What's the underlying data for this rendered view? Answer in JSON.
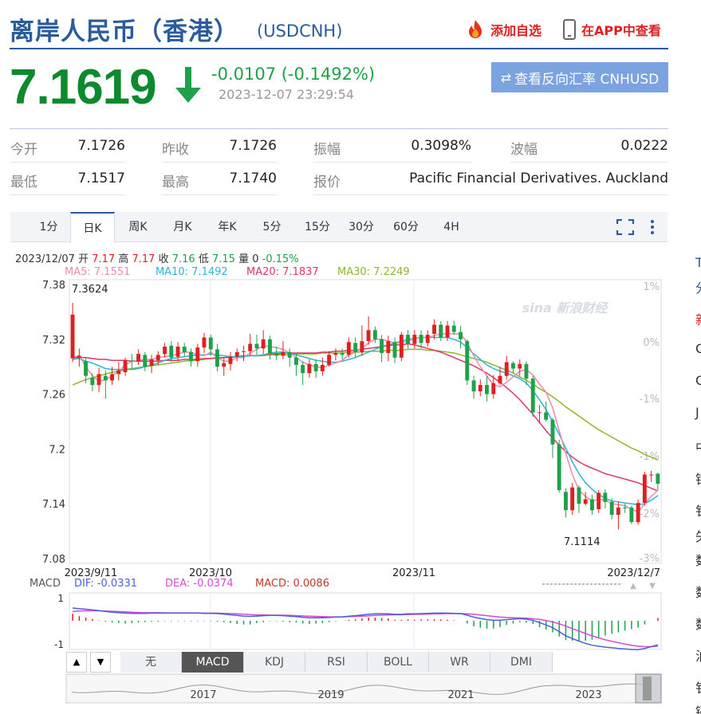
{
  "header": {
    "title": "离岸人民币（香港）",
    "symbol": "(USDCNH)",
    "add_watchlist": "添加自选",
    "view_in_app": "在APP中查看"
  },
  "quote": {
    "price": "7.1619",
    "change": "-0.0107 (-0.1492%)",
    "timestamp": "2023-12-07 23:29:54",
    "reverse_button": "查看反向汇率 CNHUSD",
    "down_color": "#0d8a2d"
  },
  "stats": [
    {
      "label": "今开",
      "value": "7.1726"
    },
    {
      "label": "昨收",
      "value": "7.1726"
    },
    {
      "label": "振幅",
      "value": "0.3098%"
    },
    {
      "label": "波幅",
      "value": "0.0222"
    },
    {
      "label": "最低",
      "value": "7.1517"
    },
    {
      "label": "最高",
      "value": "7.1740"
    },
    {
      "label": "报价",
      "value": "Pacific Financial Derivatives. Auckland"
    }
  ],
  "tabs": [
    "1分",
    "日K",
    "周K",
    "月K",
    "年K",
    "5分",
    "15分",
    "30分",
    "60分",
    "4H"
  ],
  "active_tab": "日K",
  "info_bar": {
    "date": "2023/12/07",
    "open_label": "开",
    "open": "7.17",
    "high_label": "高",
    "high": "7.17",
    "close_label": "收",
    "close": "7.16",
    "low_label": "低",
    "low": "7.15",
    "vol_label": "量",
    "vol": "0",
    "pct": "-0.15%"
  },
  "ma_legend": [
    {
      "text": "MA5: 7.1551",
      "color": "#f08aa8"
    },
    {
      "text": "MA10: 7.1492",
      "color": "#29b6d8"
    },
    {
      "text": "MA20: 7.1837",
      "color": "#e0356a"
    },
    {
      "text": "MA30: 7.2249",
      "color": "#8db82a"
    }
  ],
  "macd_legend": {
    "title": "MACD",
    "dif": "DIF: -0.0331",
    "dea": "DEA: -0.0374",
    "macd": "MACD: 0.0086"
  },
  "indicator_tabs": [
    "无",
    "MACD",
    "KDJ",
    "RSI",
    "BOLL",
    "WR",
    "DMI"
  ],
  "active_indicator": "MACD",
  "watermark": "sina 新浪财经",
  "side_letters": [
    "T",
    "分",
    "新",
    "C",
    "C",
    "J",
    "中",
    "银",
    "钅",
    "矢",
    "数",
    "数",
    "数",
    "泊",
    "钅",
    "镉"
  ],
  "chart_data": {
    "type": "candlestick",
    "y_ticks": [
      "7.38",
      "7.32",
      "7.26",
      "7.2",
      "7.14",
      "7.08"
    ],
    "pct_ticks": [
      "1%",
      "0%",
      "-1%",
      "-1%",
      "-2%",
      "-3%"
    ],
    "x_ticks": [
      "2023/9/11",
      "2023/10",
      "2023/11",
      "2023/12/7"
    ],
    "ylim": [
      7.08,
      7.38
    ],
    "max_label": "7.3624",
    "min_label": "7.1114",
    "macd_ticks": [
      "1",
      "-1"
    ],
    "overview_years": [
      "2017",
      "2019",
      "2021",
      "2023"
    ],
    "candles": [
      [
        7.299,
        7.347,
        7.36,
        7.295
      ],
      [
        7.3,
        7.302,
        7.31,
        7.29
      ],
      [
        7.296,
        7.28,
        7.3,
        7.272
      ],
      [
        7.278,
        7.27,
        7.283,
        7.263
      ],
      [
        7.27,
        7.282,
        7.289,
        7.262
      ],
      [
        7.28,
        7.275,
        7.286,
        7.255
      ],
      [
        7.275,
        7.282,
        7.29,
        7.27
      ],
      [
        7.282,
        7.286,
        7.295,
        7.275
      ],
      [
        7.284,
        7.297,
        7.3,
        7.28
      ],
      [
        7.297,
        7.296,
        7.304,
        7.288
      ],
      [
        7.296,
        7.304,
        7.309,
        7.292
      ],
      [
        7.303,
        7.29,
        7.306,
        7.285
      ],
      [
        7.291,
        7.298,
        7.303,
        7.283
      ],
      [
        7.297,
        7.303,
        7.307,
        7.292
      ],
      [
        7.304,
        7.312,
        7.316,
        7.3
      ],
      [
        7.313,
        7.3,
        7.318,
        7.295
      ],
      [
        7.301,
        7.312,
        7.317,
        7.296
      ],
      [
        7.312,
        7.306,
        7.316,
        7.301
      ],
      [
        7.306,
        7.296,
        7.31,
        7.29
      ],
      [
        7.296,
        7.311,
        7.315,
        7.29
      ],
      [
        7.311,
        7.322,
        7.327,
        7.305
      ],
      [
        7.322,
        7.309,
        7.325,
        7.302
      ],
      [
        7.309,
        7.29,
        7.315,
        7.285
      ],
      [
        7.29,
        7.294,
        7.3,
        7.28
      ],
      [
        7.293,
        7.301,
        7.306,
        7.286
      ],
      [
        7.301,
        7.306,
        7.31,
        7.296
      ],
      [
        7.306,
        7.307,
        7.313,
        7.296
      ],
      [
        7.307,
        7.315,
        7.326,
        7.302
      ],
      [
        7.315,
        7.31,
        7.325,
        7.303
      ],
      [
        7.31,
        7.32,
        7.33,
        7.304
      ],
      [
        7.32,
        7.305,
        7.324,
        7.298
      ],
      [
        7.305,
        7.302,
        7.312,
        7.297
      ],
      [
        7.302,
        7.306,
        7.318,
        7.298
      ],
      [
        7.306,
        7.3,
        7.31,
        7.29
      ],
      [
        7.3,
        7.292,
        7.304,
        7.28
      ],
      [
        7.292,
        7.283,
        7.296,
        7.27
      ],
      [
        7.283,
        7.293,
        7.298,
        7.278
      ],
      [
        7.293,
        7.285,
        7.298,
        7.278
      ],
      [
        7.285,
        7.292,
        7.3,
        7.28
      ],
      [
        7.292,
        7.303,
        7.307,
        7.29
      ],
      [
        7.303,
        7.305,
        7.31,
        7.297
      ],
      [
        7.305,
        7.303,
        7.31,
        7.298
      ],
      [
        7.303,
        7.317,
        7.322,
        7.3
      ],
      [
        7.316,
        7.306,
        7.322,
        7.3
      ],
      [
        7.306,
        7.318,
        7.335,
        7.302
      ],
      [
        7.318,
        7.33,
        7.345,
        7.314
      ],
      [
        7.33,
        7.32,
        7.334,
        7.316
      ],
      [
        7.32,
        7.305,
        7.325,
        7.295
      ],
      [
        7.305,
        7.318,
        7.324,
        7.296
      ],
      [
        7.317,
        7.3,
        7.322,
        7.294
      ],
      [
        7.3,
        7.325,
        7.328,
        7.296
      ],
      [
        7.325,
        7.315,
        7.33,
        7.31
      ],
      [
        7.315,
        7.325,
        7.33,
        7.31
      ],
      [
        7.325,
        7.316,
        7.33,
        7.31
      ],
      [
        7.316,
        7.325,
        7.33,
        7.312
      ],
      [
        7.326,
        7.336,
        7.342,
        7.32
      ],
      [
        7.336,
        7.322,
        7.34,
        7.318
      ],
      [
        7.322,
        7.335,
        7.34,
        7.318
      ],
      [
        7.335,
        7.328,
        7.34,
        7.325
      ],
      [
        7.328,
        7.32,
        7.335,
        7.31
      ],
      [
        7.318,
        7.275,
        7.32,
        7.27
      ],
      [
        7.275,
        7.263,
        7.28,
        7.255
      ],
      [
        7.263,
        7.27,
        7.276,
        7.258
      ],
      [
        7.27,
        7.26,
        7.28,
        7.252
      ],
      [
        7.26,
        7.272,
        7.281,
        7.255
      ],
      [
        7.272,
        7.28,
        7.29,
        7.27
      ],
      [
        7.28,
        7.295,
        7.302,
        7.276
      ],
      [
        7.294,
        7.288,
        7.296,
        7.283
      ],
      [
        7.288,
        7.293,
        7.298,
        7.28
      ],
      [
        7.293,
        7.277,
        7.296,
        7.27
      ],
      [
        7.277,
        7.24,
        7.28,
        7.235
      ],
      [
        7.24,
        7.24,
        7.248,
        7.228
      ],
      [
        7.24,
        7.232,
        7.252,
        7.23
      ],
      [
        7.232,
        7.205,
        7.234,
        7.19
      ],
      [
        7.205,
        7.155,
        7.21,
        7.152
      ],
      [
        7.153,
        7.133,
        7.157,
        7.125
      ],
      [
        7.133,
        7.158,
        7.163,
        7.128
      ],
      [
        7.158,
        7.14,
        7.16,
        7.13
      ],
      [
        7.14,
        7.145,
        7.153,
        7.138
      ],
      [
        7.145,
        7.133,
        7.15,
        7.128
      ],
      [
        7.134,
        7.152,
        7.155,
        7.13
      ],
      [
        7.152,
        7.142,
        7.156,
        7.135
      ],
      [
        7.142,
        7.128,
        7.146,
        7.123
      ],
      [
        7.128,
        7.136,
        7.142,
        7.112
      ],
      [
        7.136,
        7.135,
        7.14,
        7.13
      ],
      [
        7.136,
        7.12,
        7.138,
        7.118
      ],
      [
        7.12,
        7.141,
        7.145,
        7.117
      ],
      [
        7.141,
        7.172,
        7.175,
        7.138
      ],
      [
        7.172,
        7.172,
        7.176,
        7.164
      ],
      [
        7.173,
        7.162,
        7.174,
        7.155
      ]
    ],
    "ma5": [
      7.3,
      7.302,
      7.29,
      7.28,
      7.274,
      7.276,
      7.28,
      7.285,
      7.292,
      7.296,
      7.297,
      7.298,
      7.298,
      7.3,
      7.301,
      7.302,
      7.304,
      7.306,
      7.306,
      7.303,
      7.302,
      7.306,
      7.3,
      7.296,
      7.296,
      7.3,
      7.3,
      7.305,
      7.309,
      7.313,
      7.312,
      7.311,
      7.309,
      7.305,
      7.3,
      7.295,
      7.292,
      7.29,
      7.289,
      7.292,
      7.294,
      7.297,
      7.303,
      7.306,
      7.31,
      7.316,
      7.32,
      7.32,
      7.318,
      7.316,
      7.316,
      7.318,
      7.321,
      7.322,
      7.322,
      7.324,
      7.326,
      7.326,
      7.326,
      7.326,
      7.316,
      7.302,
      7.29,
      7.28,
      7.27,
      7.268,
      7.273,
      7.279,
      7.285,
      7.287,
      7.281,
      7.271,
      7.262,
      7.245,
      7.22,
      7.195,
      7.172,
      7.155,
      7.148,
      7.143,
      7.145,
      7.144,
      7.14,
      7.139,
      7.138,
      7.134,
      7.131,
      7.14,
      7.148,
      7.155
    ],
    "ma10": [
      7.298,
      7.299,
      7.296,
      7.294,
      7.291,
      7.288,
      7.287,
      7.287,
      7.287,
      7.287,
      7.288,
      7.29,
      7.292,
      7.294,
      7.297,
      7.299,
      7.3,
      7.301,
      7.302,
      7.303,
      7.303,
      7.304,
      7.303,
      7.302,
      7.301,
      7.301,
      7.301,
      7.302,
      7.302,
      7.303,
      7.305,
      7.306,
      7.306,
      7.305,
      7.303,
      7.301,
      7.299,
      7.297,
      7.296,
      7.295,
      7.295,
      7.296,
      7.298,
      7.3,
      7.303,
      7.306,
      7.309,
      7.312,
      7.314,
      7.316,
      7.318,
      7.32,
      7.321,
      7.322,
      7.322,
      7.322,
      7.322,
      7.322,
      7.32,
      7.317,
      7.311,
      7.304,
      7.298,
      7.292,
      7.288,
      7.285,
      7.283,
      7.28,
      7.277,
      7.272,
      7.264,
      7.254,
      7.243,
      7.23,
      7.216,
      7.201,
      7.186,
      7.173,
      7.163,
      7.156,
      7.15,
      7.146,
      7.143,
      7.142,
      7.141,
      7.14,
      7.139,
      7.14,
      7.144,
      7.149
    ],
    "ma20": [
      7.3,
      7.3,
      7.3,
      7.299,
      7.298,
      7.298,
      7.297,
      7.297,
      7.297,
      7.296,
      7.296,
      7.296,
      7.296,
      7.296,
      7.297,
      7.297,
      7.297,
      7.298,
      7.298,
      7.298,
      7.299,
      7.299,
      7.3,
      7.3,
      7.301,
      7.301,
      7.302,
      7.302,
      7.302,
      7.303,
      7.304,
      7.304,
      7.305,
      7.305,
      7.305,
      7.305,
      7.305,
      7.305,
      7.306,
      7.306,
      7.307,
      7.307,
      7.308,
      7.308,
      7.309,
      7.31,
      7.311,
      7.312,
      7.313,
      7.314,
      7.314,
      7.315,
      7.314,
      7.312,
      7.31,
      7.308,
      7.306,
      7.303,
      7.3,
      7.297,
      7.294,
      7.291,
      7.287,
      7.283,
      7.278,
      7.273,
      7.267,
      7.261,
      7.254,
      7.246,
      7.238,
      7.229,
      7.22,
      7.212,
      7.204,
      7.197,
      7.191,
      7.186,
      7.182,
      7.179,
      7.176,
      7.173,
      7.171,
      7.169,
      7.167,
      7.165,
      7.163,
      7.16,
      7.157,
      7.154
    ],
    "ma30": [
      7.27,
      7.273,
      7.276,
      7.278,
      7.28,
      7.282,
      7.284,
      7.285,
      7.287,
      7.288,
      7.289,
      7.29,
      7.291,
      7.292,
      7.293,
      7.294,
      7.295,
      7.296,
      7.297,
      7.297,
      7.298,
      7.299,
      7.299,
      7.3,
      7.3,
      7.301,
      7.301,
      7.302,
      7.302,
      7.302,
      7.303,
      7.303,
      7.303,
      7.303,
      7.304,
      7.304,
      7.304,
      7.304,
      7.305,
      7.305,
      7.305,
      7.305,
      7.306,
      7.306,
      7.306,
      7.307,
      7.307,
      7.307,
      7.308,
      7.308,
      7.308,
      7.309,
      7.309,
      7.309,
      7.308,
      7.308,
      7.307,
      7.306,
      7.305,
      7.303,
      7.301,
      7.299,
      7.297,
      7.295,
      7.292,
      7.289,
      7.286,
      7.283,
      7.279,
      7.275,
      7.271,
      7.266,
      7.262,
      7.257,
      7.252,
      7.246,
      7.241,
      7.236,
      7.231,
      7.226,
      7.221,
      7.217,
      7.213,
      7.209,
      7.205,
      7.201,
      7.198,
      7.194,
      7.191,
      7.188
    ],
    "dif": [
      0.55,
      0.52,
      0.5,
      0.47,
      0.44,
      0.4,
      0.37,
      0.35,
      0.33,
      0.32,
      0.32,
      0.32,
      0.33,
      0.33,
      0.33,
      0.33,
      0.33,
      0.33,
      0.33,
      0.33,
      0.32,
      0.32,
      0.31,
      0.29,
      0.26,
      0.23,
      0.2,
      0.19,
      0.2,
      0.22,
      0.23,
      0.23,
      0.22,
      0.2,
      0.18,
      0.15,
      0.13,
      0.13,
      0.13,
      0.14,
      0.16,
      0.17,
      0.2,
      0.22,
      0.25,
      0.28,
      0.3,
      0.3,
      0.3,
      0.28,
      0.28,
      0.3,
      0.3,
      0.31,
      0.32,
      0.33,
      0.33,
      0.33,
      0.32,
      0.31,
      0.24,
      0.16,
      0.1,
      0.05,
      0.02,
      0.02,
      0.05,
      0.07,
      0.09,
      0.07,
      0.02,
      -0.08,
      -0.18,
      -0.3,
      -0.47,
      -0.65,
      -0.77,
      -0.88,
      -0.98,
      -1.06,
      -1.1,
      -1.14,
      -1.17,
      -1.2,
      -1.22,
      -1.24,
      -1.25,
      -1.2,
      -1.12,
      -1.04
    ],
    "dea": [
      0.4,
      0.42,
      0.43,
      0.43,
      0.43,
      0.42,
      0.41,
      0.4,
      0.39,
      0.37,
      0.36,
      0.35,
      0.35,
      0.35,
      0.34,
      0.34,
      0.34,
      0.34,
      0.34,
      0.34,
      0.33,
      0.33,
      0.33,
      0.32,
      0.31,
      0.3,
      0.28,
      0.27,
      0.25,
      0.25,
      0.24,
      0.24,
      0.24,
      0.23,
      0.22,
      0.21,
      0.2,
      0.19,
      0.18,
      0.17,
      0.17,
      0.17,
      0.18,
      0.19,
      0.2,
      0.21,
      0.23,
      0.24,
      0.25,
      0.26,
      0.26,
      0.27,
      0.28,
      0.28,
      0.29,
      0.3,
      0.3,
      0.31,
      0.31,
      0.31,
      0.3,
      0.28,
      0.25,
      0.22,
      0.19,
      0.16,
      0.14,
      0.13,
      0.12,
      0.11,
      0.09,
      0.06,
      0.01,
      -0.05,
      -0.13,
      -0.23,
      -0.34,
      -0.44,
      -0.55,
      -0.65,
      -0.74,
      -0.82,
      -0.89,
      -0.95,
      -1.01,
      -1.06,
      -1.1,
      -1.12,
      -1.12,
      -1.1
    ]
  }
}
